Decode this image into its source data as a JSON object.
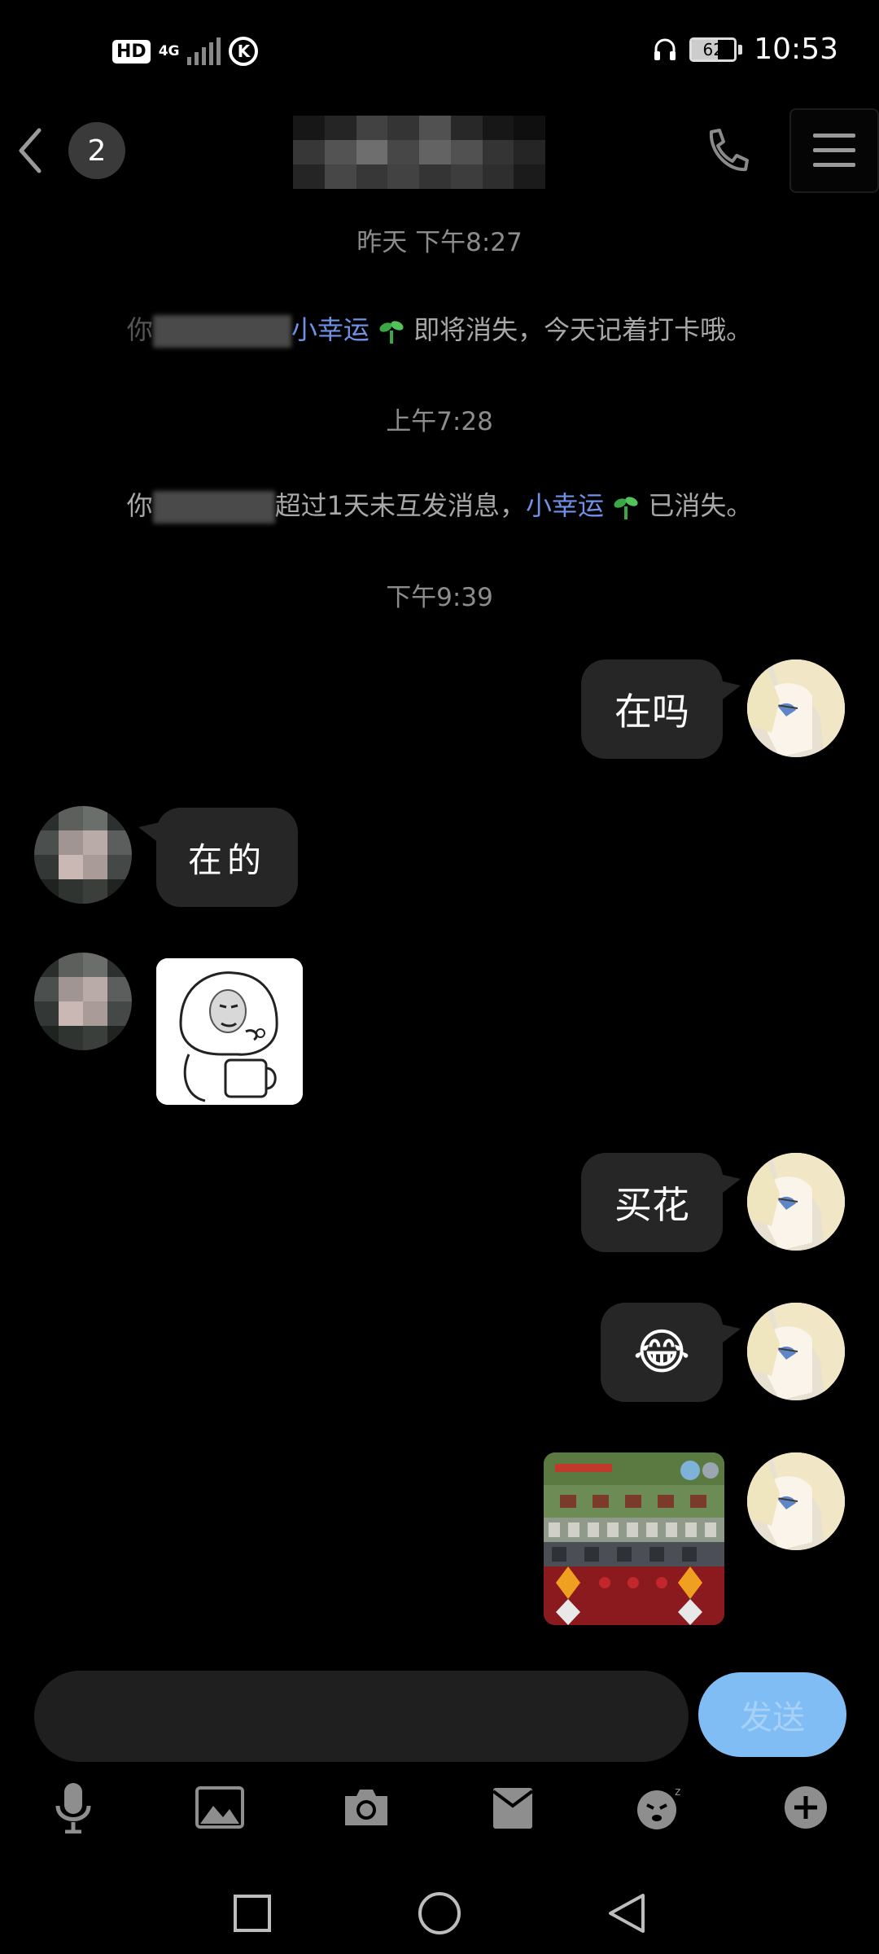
{
  "status_bar": {
    "hd_label": "HD",
    "network_label": "4G",
    "k_label": "K",
    "battery_level": "62",
    "battery_fraction": 0.62,
    "time": "10:53"
  },
  "header": {
    "unread_count": "2"
  },
  "chat": {
    "time_1": "昨天 下午8:27",
    "sys_msg_1": {
      "prefix": "你",
      "link": "小幸运",
      "suffix": "即将消失，今天记着打卡哦。"
    },
    "time_2": "上午7:28",
    "sys_msg_2": {
      "prefix": "你",
      "mid": "超过1天未互发消息，",
      "link": "小幸运",
      "suffix": "已消失。"
    },
    "time_3": "下午9:39",
    "msg_1": "在吗",
    "msg_2": "在的",
    "msg_4": "买花",
    "msg_5_emoji": "😂"
  },
  "input": {
    "placeholder": "",
    "send_label": "发送"
  },
  "toolbar": {
    "icons": [
      "microphone-icon",
      "image-icon",
      "camera-icon",
      "red-packet-icon",
      "emoji-icon",
      "plus-icon"
    ]
  },
  "nav_bar": {
    "icons": [
      "recents-square-icon",
      "home-circle-icon",
      "back-triangle-icon"
    ]
  },
  "colors": {
    "background": "#000000",
    "bubble": "#262626",
    "link": "#6f92e6",
    "send_button": "#80bdf5",
    "timestamp": "#8c8c8c"
  }
}
